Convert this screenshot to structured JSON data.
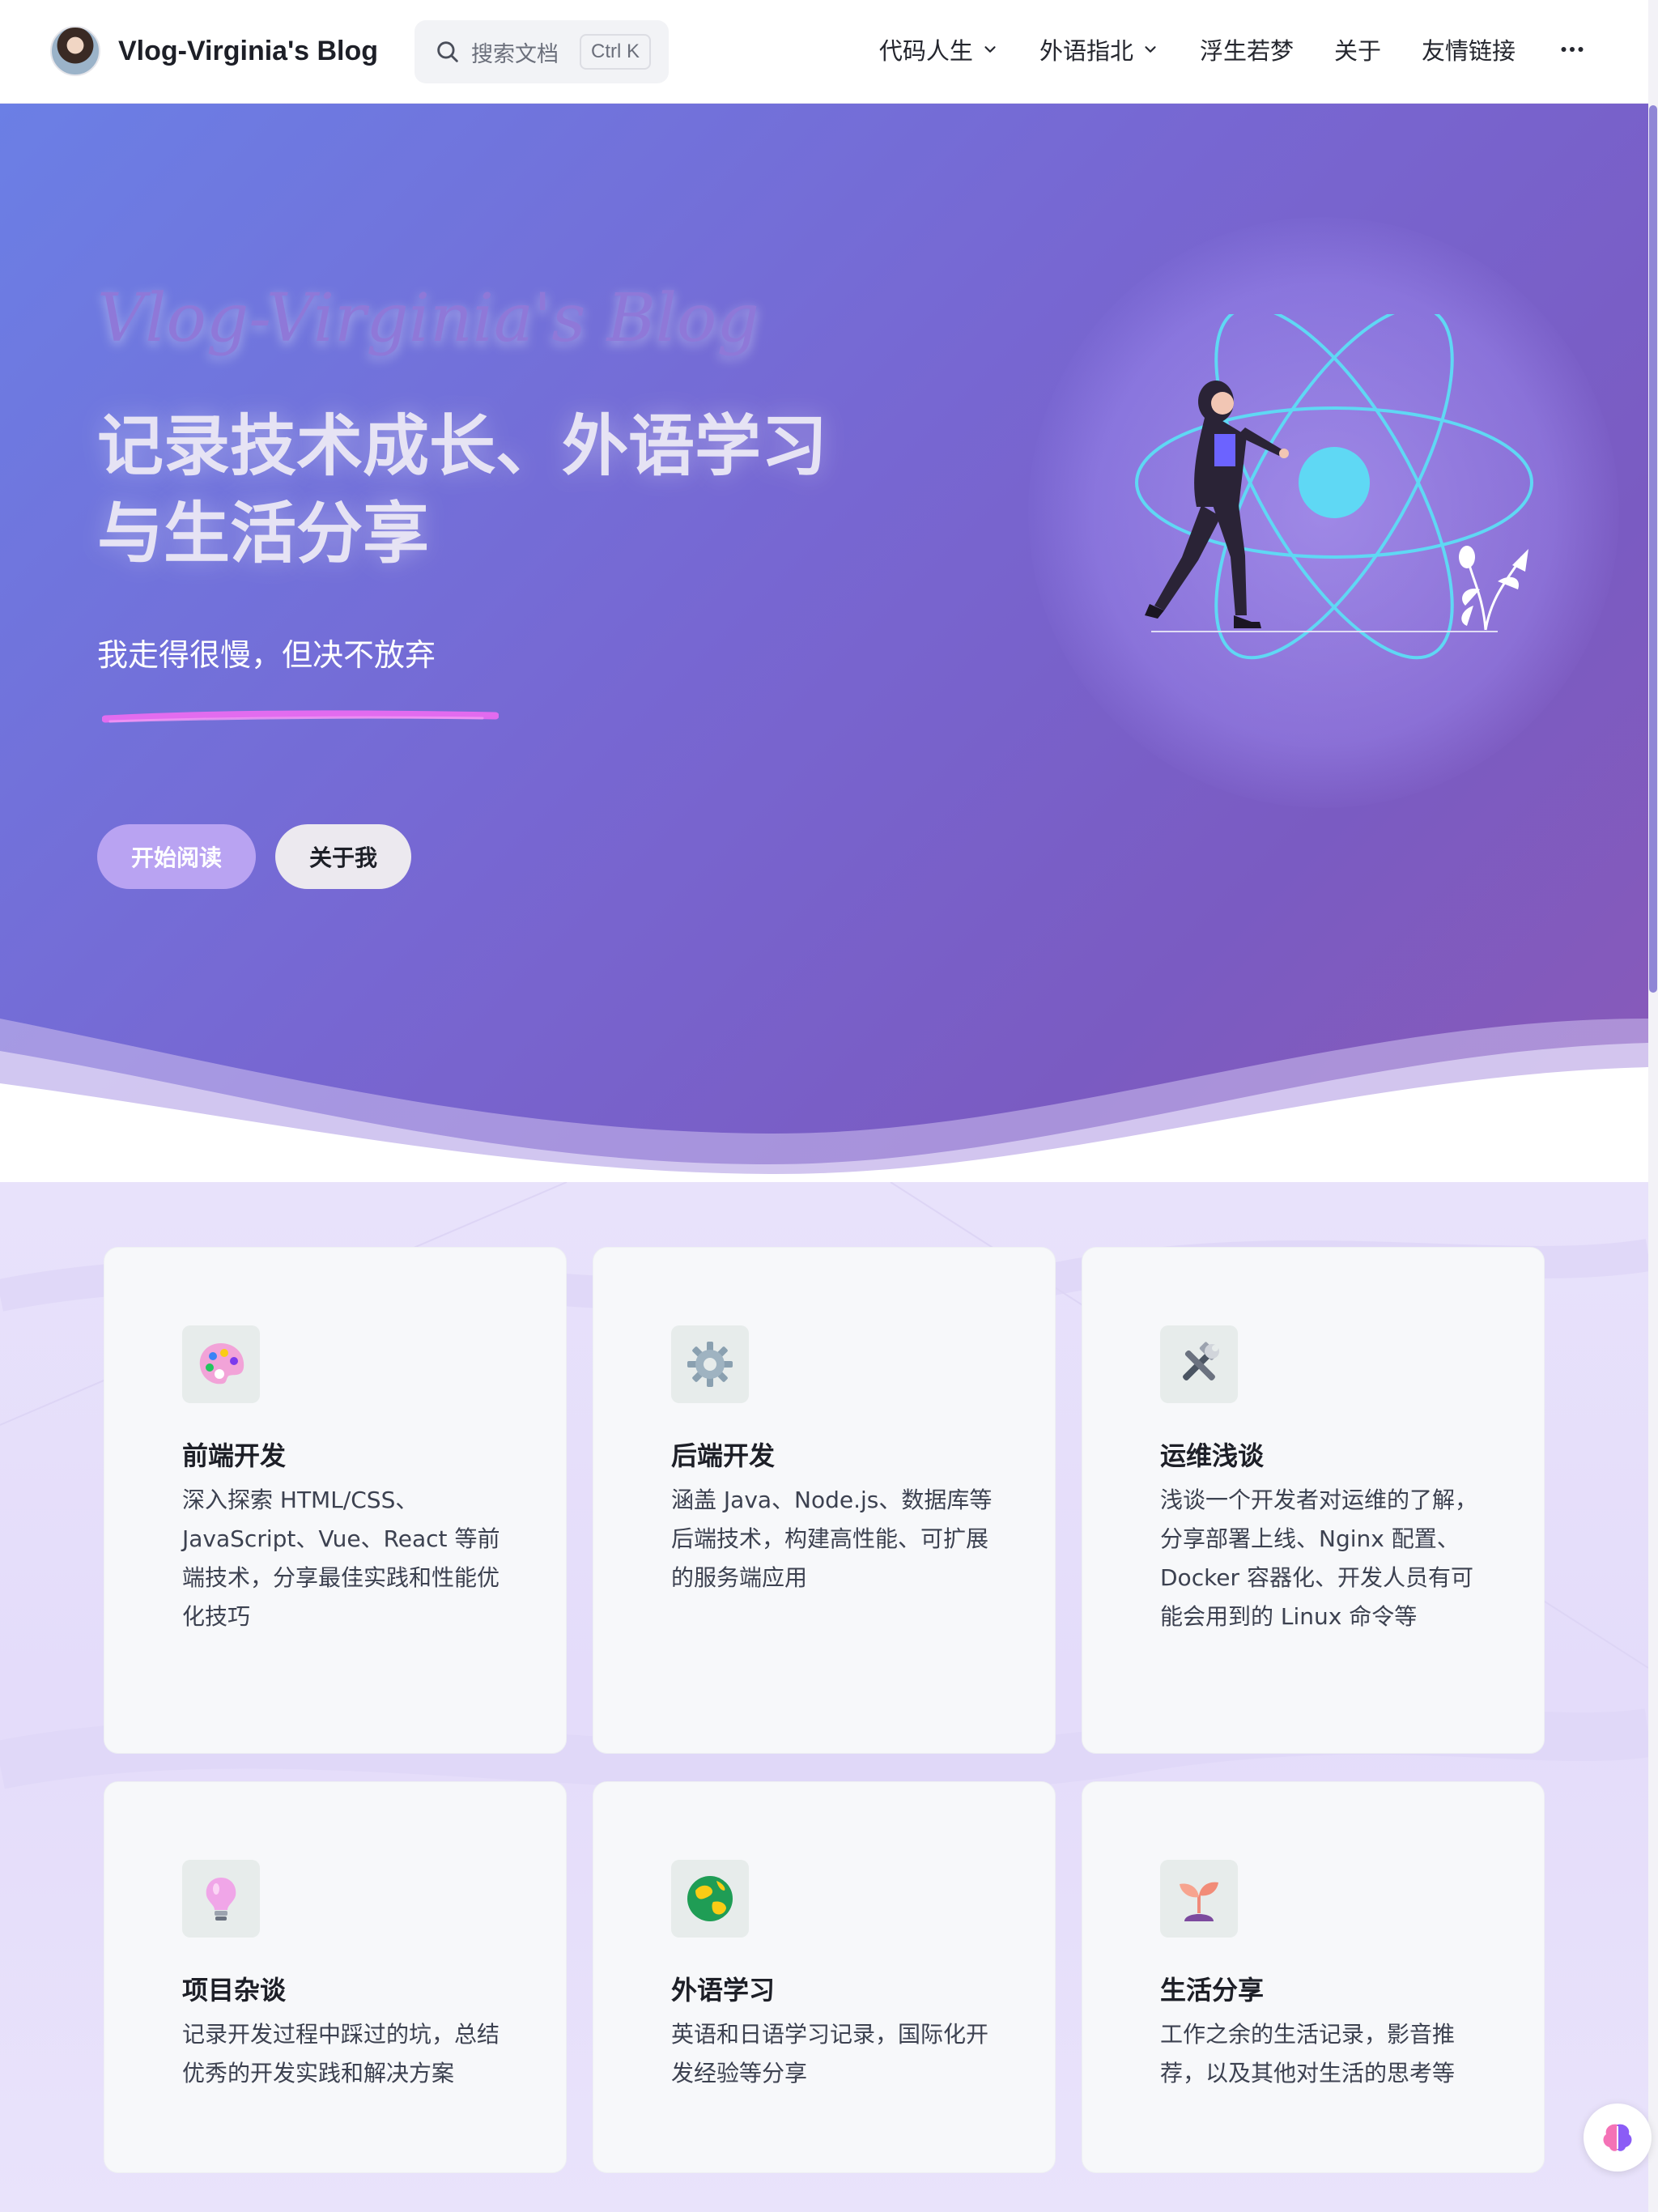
{
  "header": {
    "site_title": "Vlog-Virginia's Blog",
    "search": {
      "placeholder": "搜索文档",
      "shortcut": "Ctrl K"
    },
    "nav": [
      {
        "label": "代码人生",
        "has_dropdown": true
      },
      {
        "label": "外语指北",
        "has_dropdown": true
      },
      {
        "label": "浮生若梦",
        "has_dropdown": false
      },
      {
        "label": "关于",
        "has_dropdown": false
      },
      {
        "label": "友情链接",
        "has_dropdown": false
      }
    ],
    "more_icon": "more-horizontal-icon"
  },
  "hero": {
    "brand": "Vlog-Virginia's Blog",
    "headline_line1": "记录技术成长、外语学习",
    "headline_line2": "与生活分享",
    "tagline": "我走得很慢，但决不放弃",
    "primary_button": "开始阅读",
    "secondary_button": "关于我",
    "illustration": "woman-walking-atom-illustration"
  },
  "features": [
    {
      "icon": "artist-palette-icon",
      "title": "前端开发",
      "description": "深入探索 HTML/CSS、JavaScript、Vue、React 等前端技术，分享最佳实践和性能优化技巧"
    },
    {
      "icon": "gear-icon",
      "title": "后端开发",
      "description": "涵盖 Java、Node.js、数据库等后端技术，构建高性能、可扩展的服务端应用"
    },
    {
      "icon": "hammer-wrench-icon",
      "title": "运维浅谈",
      "description": "浅谈一个开发者对运维的了解，分享部署上线、Nginx 配置、Docker 容器化、开发人员有可能会用到的 Linux 命令等"
    },
    {
      "icon": "light-bulb-icon",
      "title": "项目杂谈",
      "description": "记录开发过程中踩过的坑，总结优秀的开发实践和解决方案"
    },
    {
      "icon": "globe-icon",
      "title": "外语学习",
      "description": "英语和日语学习记录，国际化开发经验等分享"
    },
    {
      "icon": "seedling-icon",
      "title": "生活分享",
      "description": "工作之余的生活记录，影音推荐，以及其他对生活的思考等"
    }
  ],
  "colors": {
    "hero_gradient_start": "#6b7fe5",
    "hero_gradient_end": "#8a5ab8",
    "accent_button": "#b9a3f2",
    "brush_pink": "#e86cf0",
    "atom_cyan": "#5fd8f4"
  }
}
